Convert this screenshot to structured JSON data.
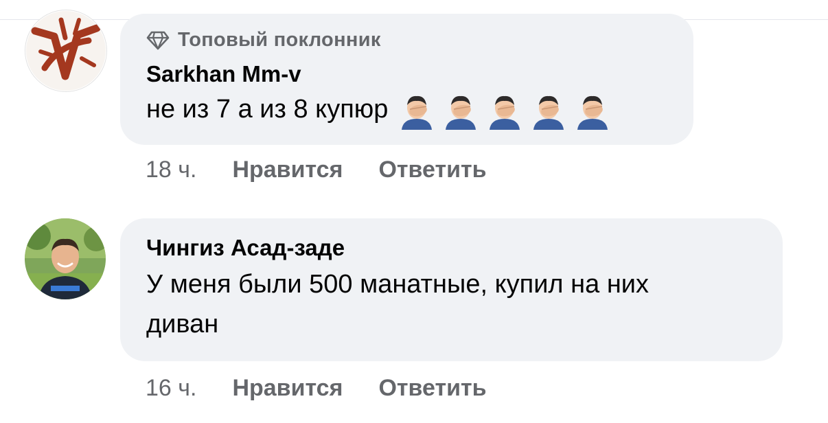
{
  "comments": [
    {
      "badge": "Топовый поклонник",
      "badge_icon": "diamond-icon",
      "author": "Sarkhan Mm-v",
      "text": "не из 7 а из 8 купюр",
      "emojis": [
        "facepalm-emoji",
        "facepalm-emoji",
        "facepalm-emoji",
        "facepalm-emoji",
        "facepalm-emoji"
      ],
      "time": "18 ч.",
      "like": "Нравится",
      "reply": "Ответить"
    },
    {
      "author": "Чингиз Асад-заде",
      "text_line1": "У меня были 500 манатные, купил на них",
      "text_line2": "диван",
      "time": "16 ч.",
      "like": "Нравится",
      "reply": "Ответить"
    }
  ],
  "colors": {
    "bubble": "#f0f2f5",
    "text": "#050505",
    "secondary": "#65676b"
  }
}
